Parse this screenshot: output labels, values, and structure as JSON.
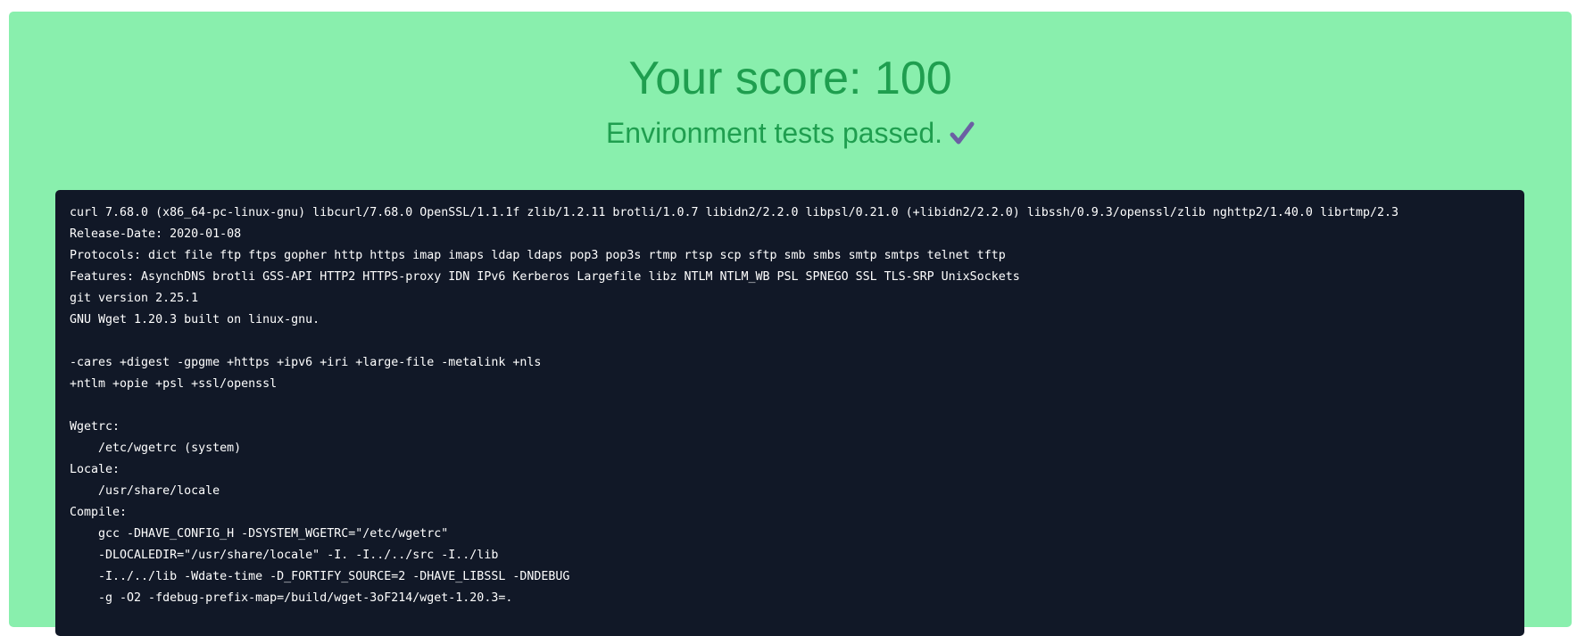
{
  "result": {
    "score_text": "Your score: 100",
    "status_text": "Environment tests passed.",
    "check_icon": "checkmark-icon"
  },
  "colors": {
    "card_bg": "#89efad",
    "heading": "#1f9e4f",
    "check": "#6b5fa3",
    "terminal_bg": "#111827",
    "terminal_text": "#ffffff"
  },
  "terminal": {
    "lines": [
      "curl 7.68.0 (x86_64-pc-linux-gnu) libcurl/7.68.0 OpenSSL/1.1.1f zlib/1.2.11 brotli/1.0.7 libidn2/2.2.0 libpsl/0.21.0 (+libidn2/2.2.0) libssh/0.9.3/openssl/zlib nghttp2/1.40.0 librtmp/2.3",
      "Release-Date: 2020-01-08",
      "Protocols: dict file ftp ftps gopher http https imap imaps ldap ldaps pop3 pop3s rtmp rtsp scp sftp smb smbs smtp smtps telnet tftp",
      "Features: AsynchDNS brotli GSS-API HTTP2 HTTPS-proxy IDN IPv6 Kerberos Largefile libz NTLM NTLM_WB PSL SPNEGO SSL TLS-SRP UnixSockets",
      "git version 2.25.1",
      "GNU Wget 1.20.3 built on linux-gnu.",
      "",
      "-cares +digest -gpgme +https +ipv6 +iri +large-file -metalink +nls",
      "+ntlm +opie +psl +ssl/openssl",
      "",
      "Wgetrc:",
      "    /etc/wgetrc (system)",
      "Locale:",
      "    /usr/share/locale",
      "Compile:",
      "    gcc -DHAVE_CONFIG_H -DSYSTEM_WGETRC=\"/etc/wgetrc\"",
      "    -DLOCALEDIR=\"/usr/share/locale\" -I. -I../../src -I../lib",
      "    -I../../lib -Wdate-time -D_FORTIFY_SOURCE=2 -DHAVE_LIBSSL -DNDEBUG",
      "    -g -O2 -fdebug-prefix-map=/build/wget-3oF214/wget-1.20.3=."
    ]
  }
}
